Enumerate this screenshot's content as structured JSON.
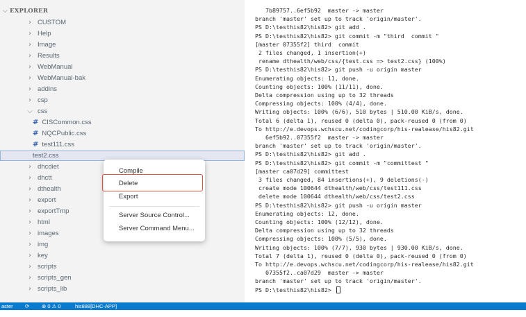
{
  "explorer": {
    "header": "EXPLORER",
    "items": [
      {
        "label": "CUSTOM",
        "twisty": ">",
        "hash": false
      },
      {
        "label": "Help",
        "twisty": ">",
        "hash": false
      },
      {
        "label": "Image",
        "twisty": ">",
        "hash": false
      },
      {
        "label": "Results",
        "twisty": ">",
        "hash": false
      },
      {
        "label": "WebManual",
        "twisty": ">",
        "hash": false
      },
      {
        "label": "WebManual-bak",
        "twisty": ">",
        "hash": false
      },
      {
        "label": "addins",
        "twisty": ">",
        "hash": false
      },
      {
        "label": "csp",
        "twisty": ">",
        "hash": false
      },
      {
        "label": "css",
        "twisty": "v",
        "hash": false
      },
      {
        "label": "CISCommon.css",
        "twisty": "",
        "hash": true
      },
      {
        "label": "NQCPublic.css",
        "twisty": "",
        "hash": true
      },
      {
        "label": "test111.css",
        "twisty": "",
        "hash": true
      },
      {
        "label": "test2.css",
        "twisty": "",
        "hash": false,
        "selected": true
      },
      {
        "label": "dhcdiet",
        "twisty": ">",
        "hash": false
      },
      {
        "label": "dhctt",
        "twisty": ">",
        "hash": false
      },
      {
        "label": "dthealth",
        "twisty": ">",
        "hash": false
      },
      {
        "label": "export",
        "twisty": ">",
        "hash": false
      },
      {
        "label": "exportTmp",
        "twisty": ">",
        "hash": false
      },
      {
        "label": "html",
        "twisty": ">",
        "hash": false
      },
      {
        "label": "images",
        "twisty": ">",
        "hash": false
      },
      {
        "label": "img",
        "twisty": ">",
        "hash": false
      },
      {
        "label": "key",
        "twisty": ">",
        "hash": false
      },
      {
        "label": "scripts",
        "twisty": ">",
        "hash": false
      },
      {
        "label": "scripts_gen",
        "twisty": ">",
        "hash": false
      },
      {
        "label": "scripts_lib",
        "twisty": ">",
        "hash": false
      }
    ]
  },
  "context_menu": {
    "items": [
      "Compile",
      "Delete",
      "Export",
      "Server Source Control...",
      "Server Command Menu..."
    ],
    "highlighted": "Delete"
  },
  "terminal": {
    "lines": [
      "   7b89757..6ef5b92  master -> master",
      "branch 'master' set up to track 'origin/master'.",
      "PS D:\\testhis82\\his82> git add .",
      "PS D:\\testhis82\\his82> git commit -m \"third  commit \"",
      "[master 07355f2] third  commit",
      " 2 files changed, 1 insertion(+)",
      " rename dthealth/web/css/{test.css => test2.css} (100%)",
      "PS D:\\testhis82\\his82> git push -u origin master",
      "Enumerating objects: 11, done.",
      "Counting objects: 100% (11/11), done.",
      "Delta compression using up to 32 threads",
      "Compressing objects: 100% (4/4), done.",
      "Writing objects: 100% (6/6), 510 bytes | 510.00 KiB/s, done.",
      "Total 6 (delta 1), reused 0 (delta 0), pack-reused 0 (from 0)",
      "To http://e.devops.wchscu.net/codingcorp/his-realease/his82.git",
      "   6ef5b92..07355f2  master -> master",
      "branch 'master' set up to track 'origin/master'.",
      "PS D:\\testhis82\\his82> git add .",
      "PS D:\\testhis82\\his82> git commit -m \"committest \"",
      "[master ca07d29] committest",
      " 3 files changed, 84 insertions(+), 9 deletions(-)",
      " create mode 100644 dthealth/web/css/test111.css",
      " delete mode 100644 dthealth/web/css/test2.css",
      "PS D:\\testhis82\\his82> git push -u origin master",
      "Enumerating objects: 12, done.",
      "Counting objects: 100% (12/12), done.",
      "Delta compression using up to 32 threads",
      "Compressing objects: 100% (5/5), done.",
      "Writing objects: 100% (7/7), 930 bytes | 930.00 KiB/s, done.",
      "Total 7 (delta 1), reused 0 (delta 0), pack-reused 0 (from 0)",
      "To http://e.devops.wchscu.net/codingcorp/his-realease/his82.git",
      "   07355f2..ca07d29  master -> master",
      "branch 'master' set up to track 'origin/master'.",
      "PS D:\\testhis82\\his82> "
    ]
  },
  "status_bar": {
    "branch": "aster",
    "sync_icon": "sync-icon",
    "problems": "⊗ 0 ⚠ 0",
    "server": "his888[DHC-APP]"
  },
  "colors": {
    "status_bar": "#0a7acc",
    "highlight_border": "#e0533f",
    "selected_row": "#e4e6f1"
  }
}
